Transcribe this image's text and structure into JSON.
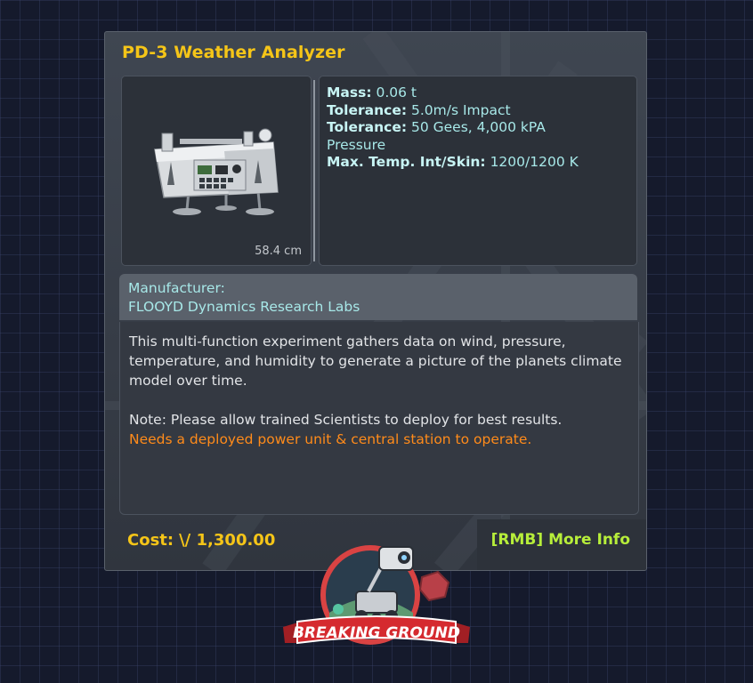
{
  "tooltip": {
    "title": "PD-3 Weather Analyzer",
    "size_label": "58.4 cm",
    "stats": [
      {
        "label": "Mass:",
        "value": "0.06 t"
      },
      {
        "label": "Tolerance:",
        "value": "5.0m/s Impact"
      },
      {
        "label": "Tolerance:",
        "value": "50 Gees, 4,000 kPA Pressure"
      },
      {
        "label": "Max. Temp. Int/Skin:",
        "value": "1200/1200 K"
      }
    ],
    "manufacturer_label": "Manufacturer:",
    "manufacturer_name": "FLOOYD Dynamics Research Labs",
    "description": "This multi-function experiment gathers data on wind, pressure, temperature, and humidity to generate a picture of the planets climate model over time.",
    "note": "Note: Please allow trained Scientists to deploy for best results.",
    "warning": "Needs a deployed power unit & central station to operate.",
    "cost_label": "Cost:",
    "cost_icon": "\\/",
    "cost_value": "1,300.00",
    "more_info": "[RMB] More Info"
  },
  "logo": {
    "text": "BREAKING GROUND"
  },
  "colors": {
    "title": "#f5c518",
    "stats_text": "#a7e8e8",
    "warning": "#ff8b1a",
    "more_info": "#b7ee3a"
  },
  "icons": [
    "part-thumbnail-icon",
    "funds-icon",
    "breaking-ground-logo-icon"
  ]
}
